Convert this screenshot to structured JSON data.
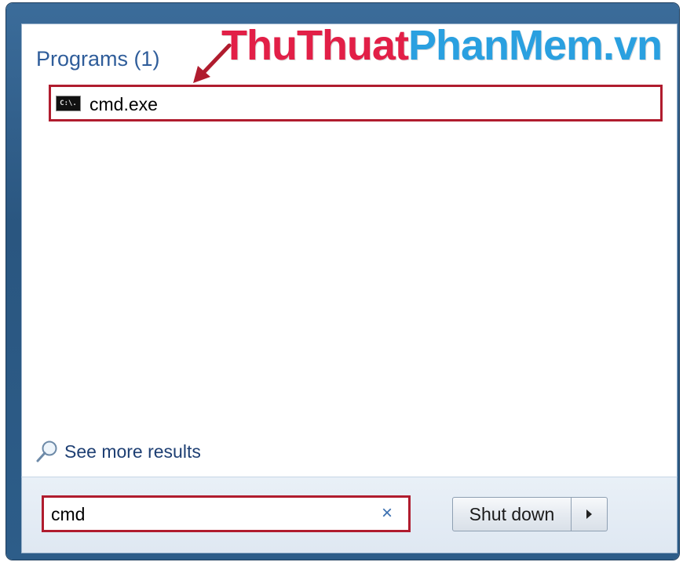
{
  "results": {
    "section_title": "Programs (1)",
    "items": [
      {
        "label": "cmd.exe",
        "icon": "cmd-icon",
        "icon_text": "C:\\."
      }
    ],
    "see_more_label": "See more results"
  },
  "search": {
    "value": "cmd",
    "clear_glyph": "×"
  },
  "shutdown": {
    "label": "Shut down"
  },
  "watermark": {
    "part1": "ThuThuat",
    "part2": "PhanMem.vn"
  },
  "colors": {
    "highlight": "#b01c2e",
    "section_title": "#2f5d9a",
    "link": "#1e3f73",
    "watermark_red": "#e21f47",
    "watermark_blue": "#2aa0e0"
  }
}
